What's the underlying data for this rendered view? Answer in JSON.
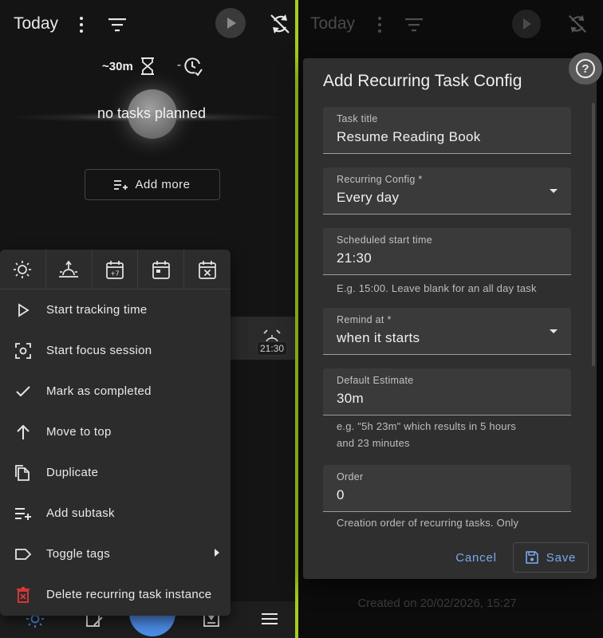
{
  "left": {
    "header": {
      "title": "Today"
    },
    "estimate": {
      "time": "~30m",
      "clock_prefix": "-"
    },
    "empty_state": "no tasks planned",
    "add_more_label": "Add more",
    "task": {
      "reminder_time": "21:30"
    },
    "context_menu": {
      "shortcuts": [
        "sun-icon",
        "sunset-icon",
        "calendar-plus7-icon",
        "calendar-icon",
        "calendar-remove-icon"
      ],
      "shortcut_badge": "+7",
      "items": [
        {
          "label": "Start tracking time",
          "icon": "play-outline-icon"
        },
        {
          "label": "Start focus session",
          "icon": "focus-icon"
        },
        {
          "label": "Mark as completed",
          "icon": "check-icon"
        },
        {
          "label": "Move to top",
          "icon": "arrow-up-icon"
        },
        {
          "label": "Duplicate",
          "icon": "copy-icon"
        },
        {
          "label": "Add subtask",
          "icon": "playlist-add-icon"
        },
        {
          "label": "Toggle tags",
          "icon": "tag-icon"
        },
        {
          "label": "Delete recurring task instance",
          "icon": "delete-icon"
        }
      ]
    },
    "colors": {
      "delete_icon": "#e53935",
      "fab": "#4e8de8"
    }
  },
  "right": {
    "header": {
      "title": "Today"
    },
    "created_at": "Created on 20/02/2026, 15:27",
    "dialog": {
      "title": "Add Recurring Task Config",
      "fields": {
        "task_title": {
          "label": "Task title",
          "value": "Resume Reading Book"
        },
        "recurring_config": {
          "label": "Recurring Config *",
          "value": "Every day"
        },
        "start_time": {
          "label": "Scheduled start time",
          "value": "21:30",
          "hint": "E.g. 15:00. Leave blank for an all day task"
        },
        "remind_at": {
          "label": "Remind at *",
          "value": "when it starts"
        },
        "default_estimate": {
          "label": "Default Estimate",
          "value": "30m",
          "hint_line1": "e.g. \"5h 23m\" which results in 5 hours",
          "hint_line2": "and 23 minutes"
        },
        "order": {
          "label": "Order",
          "value": "0",
          "hint": "Creation order of recurring tasks. Only"
        }
      },
      "cancel_label": "Cancel",
      "save_label": "Save"
    },
    "help_label": "?"
  },
  "accent": {
    "divider": "#a6cc1e",
    "link": "#7aa9ee"
  }
}
